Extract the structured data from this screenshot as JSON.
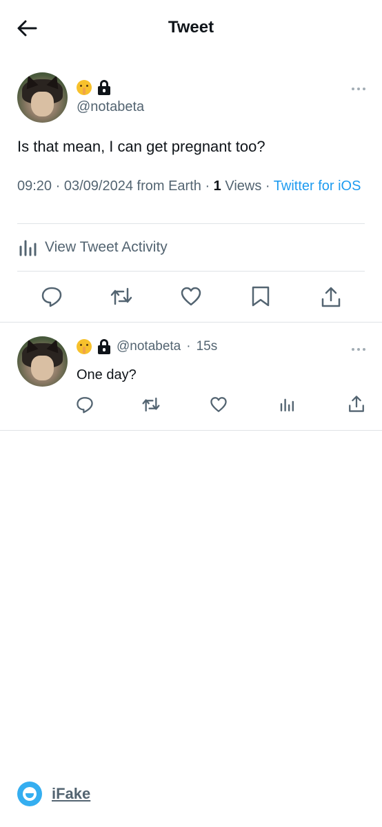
{
  "header": {
    "title": "Tweet",
    "back_icon": "arrow-left-icon"
  },
  "tweet": {
    "display_emoji": "shushing-face",
    "verified_lock_icon": "lock-icon",
    "handle": "@notabeta",
    "text": "Is that mean, I can get pregnant too?",
    "time": "09:20",
    "date": "03/09/2024",
    "location": "from Earth",
    "views_count": "1",
    "views_label": "Views",
    "source": "Twitter for iOS",
    "activity_label": "View Tweet Activity",
    "actions": [
      "reply-icon",
      "retweet-icon",
      "like-icon",
      "bookmark-icon",
      "share-icon"
    ]
  },
  "reply": {
    "handle": "@notabeta",
    "age": "15s",
    "text": "One day?",
    "actions": [
      "reply-icon",
      "retweet-icon",
      "like-icon",
      "analytics-icon",
      "share-icon"
    ]
  },
  "watermark": {
    "label": "iFake"
  },
  "colors": {
    "text_primary": "#0f1419",
    "text_secondary": "#536471",
    "link": "#1d9bf0",
    "divider": "#dfe3e6"
  }
}
